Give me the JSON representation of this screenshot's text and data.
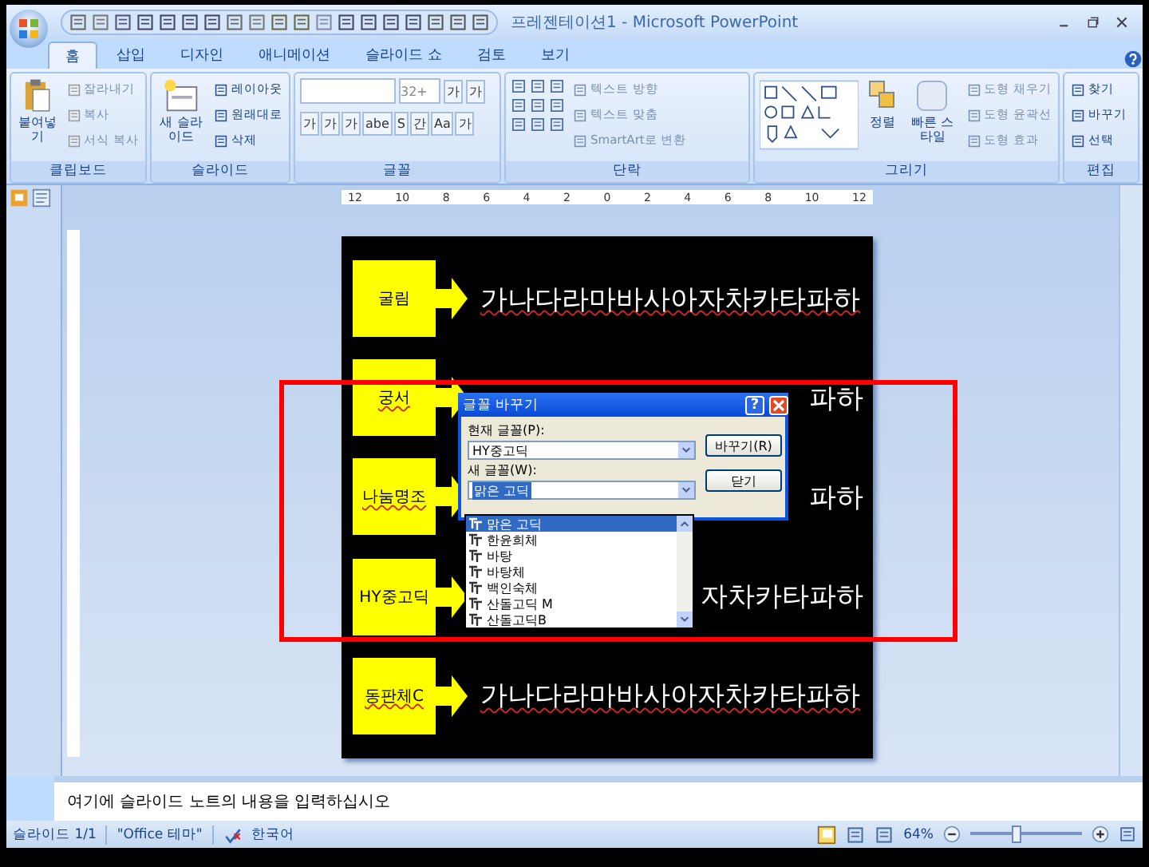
{
  "window": {
    "title": "프레젠테이션1 - Microsoft PowerPoint"
  },
  "tabs": [
    {
      "label": "홈",
      "selected": true
    },
    {
      "label": "삽입",
      "selected": false
    },
    {
      "label": "디자인",
      "selected": false
    },
    {
      "label": "애니메이션",
      "selected": false
    },
    {
      "label": "슬라이드 쇼",
      "selected": false
    },
    {
      "label": "검토",
      "selected": false
    },
    {
      "label": "보기",
      "selected": false
    }
  ],
  "ribbon": {
    "clipboard": {
      "label": "클립보드",
      "paste": "붙여넣기",
      "items": [
        "잘라내기",
        "복사",
        "서식 복사"
      ]
    },
    "slides": {
      "label": "슬라이드",
      "new_slide": "새 슬라이드",
      "items": [
        "레이아웃",
        "원래대로",
        "삭제"
      ]
    },
    "font": {
      "label": "글꼴",
      "size": "32+",
      "size_buttons": [
        "가",
        "가"
      ],
      "format_buttons": [
        "가",
        "가",
        "가",
        "abe",
        "S",
        "간",
        "Aa",
        "가"
      ]
    },
    "paragraph": {
      "label": "단락",
      "items": [
        "텍스트 방향",
        "텍스트 맞춤",
        "SmartArt로 변환"
      ]
    },
    "drawing": {
      "label": "그리기",
      "arrange": "정렬",
      "quick_styles": "빠른 스타일",
      "items": [
        "도형 채우기",
        "도형 윤곽선",
        "도형 효과"
      ]
    },
    "editing": {
      "label": "편집",
      "items": [
        "찾기",
        "바꾸기",
        "선택"
      ]
    }
  },
  "ruler": [
    "12",
    "10",
    "8",
    "6",
    "4",
    "2",
    "0",
    "2",
    "4",
    "6",
    "8",
    "10",
    "12"
  ],
  "slide": {
    "rows": [
      {
        "label": "굴림",
        "label_spell_error": false,
        "text": "가나다라마바사아자차카타파하",
        "text_spell_error": true
      },
      {
        "label": "궁서",
        "label_spell_error": true,
        "text": "파하",
        "text_spell_error": false
      },
      {
        "label": "나눔명조",
        "label_spell_error": true,
        "text": "파하",
        "text_spell_error": false
      },
      {
        "label": "HY중고딕",
        "label_spell_error": false,
        "text": "자차카타파하",
        "text_spell_error": false
      },
      {
        "label": "동판체C",
        "label_spell_error": true,
        "text": "가나다라마바사아자차카타파하",
        "text_spell_error": true
      }
    ]
  },
  "dialog": {
    "title": "글꼴 바꾸기",
    "help": "?",
    "current_label": "현재 글꼴(P):",
    "current_value": "HY중고딕",
    "new_label": "새 글꼴(W):",
    "new_value": "맑은 고딕",
    "options": [
      {
        "label": "맑은 고딕",
        "selected": true
      },
      {
        "label": "한윤희체",
        "selected": false
      },
      {
        "label": "바탕",
        "selected": false
      },
      {
        "label": "바탕체",
        "selected": false
      },
      {
        "label": "백인숙체",
        "selected": false
      },
      {
        "label": "산돌고딕 M",
        "selected": false
      },
      {
        "label": "산돌고딕B",
        "selected": false
      }
    ],
    "buttons": [
      "바꾸기(R)",
      "닫기"
    ]
  },
  "notes": {
    "placeholder": "여기에 슬라이드 노트의 내용을 입력하십시오"
  },
  "status_bar": {
    "slide": "슬라이드 1/1",
    "theme": "\"Office 테마\"",
    "language": "한국어",
    "zoom": "64%",
    "zoom_slider": {
      "level": 0.42
    }
  }
}
